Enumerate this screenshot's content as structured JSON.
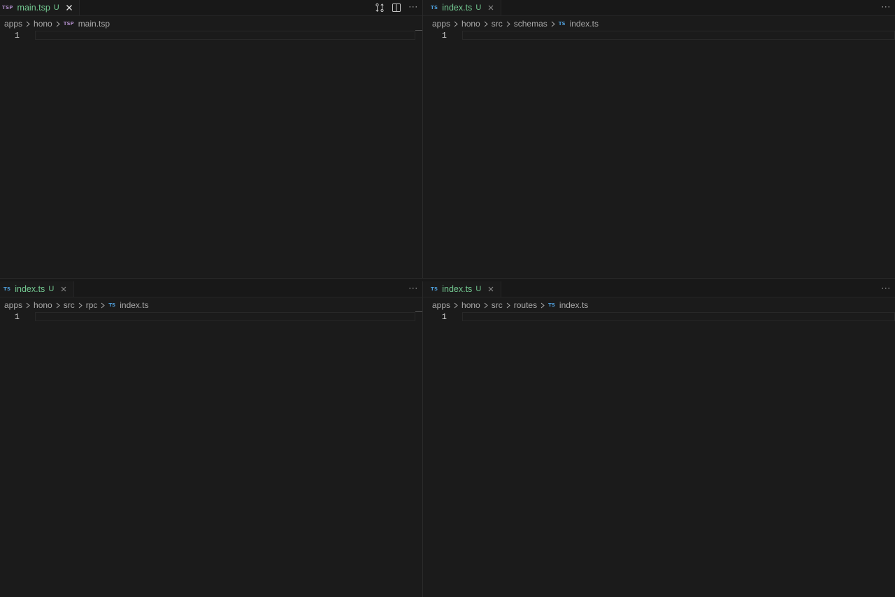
{
  "colors": {
    "modified_tab": "#73c991",
    "ts_icon": "#4d9bd6",
    "tsp_icon": "#a887c0",
    "background": "#1b1b1b"
  },
  "groups": {
    "top_left": {
      "tab": {
        "icon": "TSP",
        "name": "main.tsp",
        "status": "U",
        "close_icon": "close-icon"
      },
      "actions": [
        "open-changes-icon",
        "split-editor-icon",
        "more-actions-icon"
      ],
      "more_label": "···",
      "breadcrumb": [
        "apps",
        "hono"
      ],
      "file_icon": "TSP",
      "file_name": "main.tsp",
      "line_number": "1"
    },
    "top_right": {
      "tab": {
        "icon": "TS",
        "name": "index.ts",
        "status": "U",
        "close_icon": "close-icon"
      },
      "more_label": "···",
      "breadcrumb": [
        "apps",
        "hono",
        "src",
        "schemas"
      ],
      "file_icon": "TS",
      "file_name": "index.ts",
      "line_number": "1"
    },
    "bottom_left": {
      "tab": {
        "icon": "TS",
        "name": "index.ts",
        "status": "U",
        "close_icon": "close-icon"
      },
      "more_label": "···",
      "breadcrumb": [
        "apps",
        "hono",
        "src",
        "rpc"
      ],
      "file_icon": "TS",
      "file_name": "index.ts",
      "line_number": "1"
    },
    "bottom_right": {
      "tab": {
        "icon": "TS",
        "name": "index.ts",
        "status": "U",
        "close_icon": "close-icon"
      },
      "more_label": "···",
      "breadcrumb": [
        "apps",
        "hono",
        "src",
        "routes"
      ],
      "file_icon": "TS",
      "file_name": "index.ts",
      "line_number": "1"
    }
  }
}
